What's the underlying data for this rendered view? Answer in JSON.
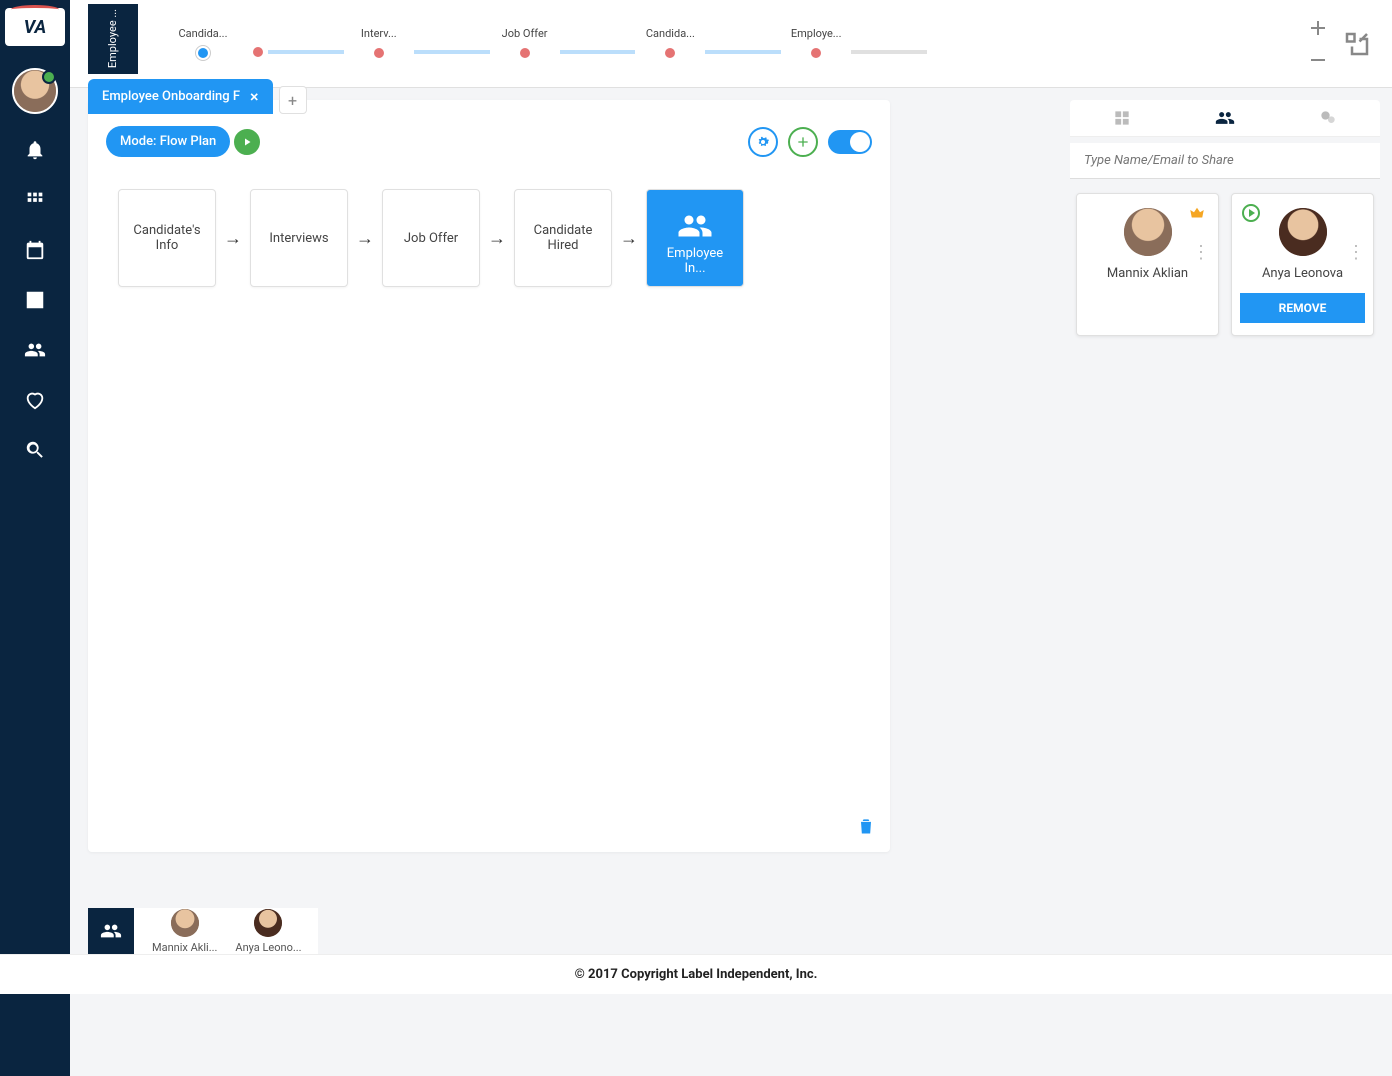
{
  "sidebar": {
    "logo_text": "VA"
  },
  "topbar": {
    "vert_tab": "Employee ...",
    "progress": [
      "Candida...",
      "Interv...",
      "Job Offer",
      "Candida...",
      "Employe..."
    ]
  },
  "tab": {
    "title": "Employee Onboarding F"
  },
  "mode": {
    "label": "Mode: Flow Plan"
  },
  "flow": {
    "cards": [
      "Candidate's Info",
      "Interviews",
      "Job Offer",
      "Candidate Hired",
      "Employee In..."
    ]
  },
  "share": {
    "placeholder": "Type Name/Email to Share"
  },
  "users": [
    {
      "name": "Mannix Aklian",
      "owner": true,
      "removable": false
    },
    {
      "name": "Anya Leonova",
      "owner": false,
      "removable": true
    }
  ],
  "remove_label": "REMOVE",
  "bottom_users": [
    "Mannix Akli...",
    "Anya Leono..."
  ],
  "footer": "© 2017 Copyright Label Independent, Inc."
}
